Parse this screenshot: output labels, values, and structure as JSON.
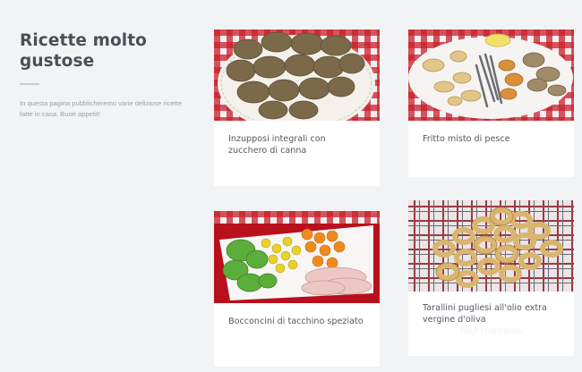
{
  "intro": {
    "title": "Ricette molto gustose",
    "description": "In questa pagina pubblicheremo varie deliziose ricette fatte in casa. Buon appetit!"
  },
  "recipes": [
    {
      "title": "Inzupposi integrali con zucchero di canna",
      "image_icon": "cookies-photo"
    },
    {
      "title": "Fritto misto di pesce",
      "image_icon": "fried-fish-photo"
    },
    {
      "title": "Bocconcini di tacchino speziato",
      "image_icon": "turkey-salad-photo"
    },
    {
      "title": "Tarallini pugliesi all'olio extra vergine d'oliva",
      "image_icon": "taralli-photo"
    }
  ],
  "watermark": "ПАРТНЕРКИН",
  "colors": {
    "background": "#f2f3f5",
    "heading": "#4b4f56",
    "muted_text": "#9ca1a7",
    "card": "#ffffff",
    "tablecloth_red": "#c8202a"
  }
}
